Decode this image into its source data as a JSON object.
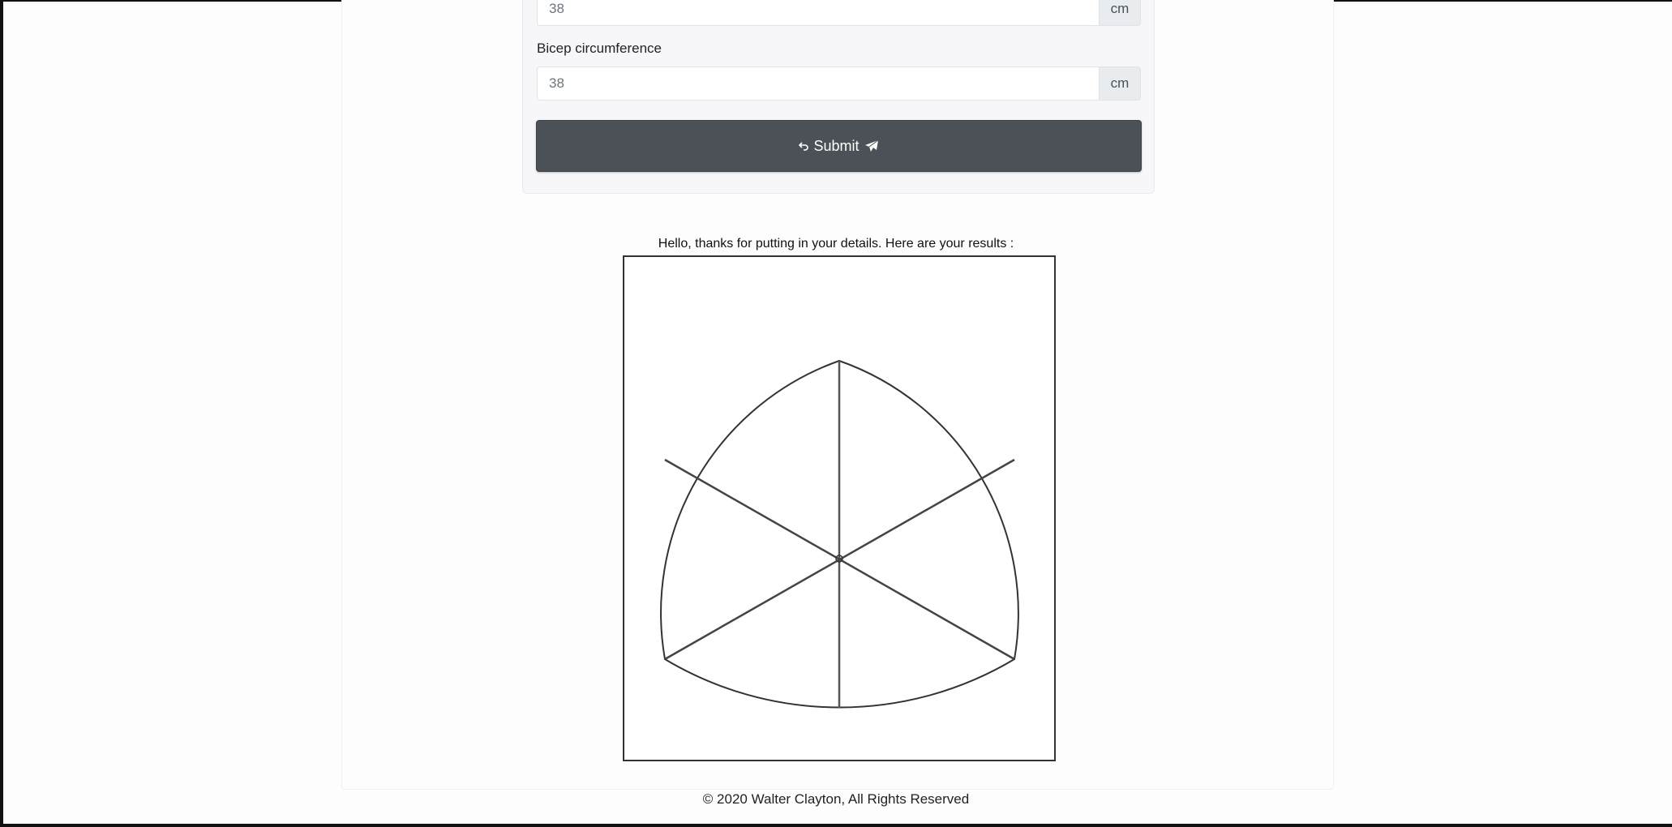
{
  "form": {
    "prev_field": {
      "value": "38",
      "unit": "cm"
    },
    "bicep_field": {
      "label": "Bicep circumference",
      "value": "38",
      "unit": "cm"
    },
    "submit_label": "Submit"
  },
  "results": {
    "message": "Hello, thanks for putting in your details. Here are your results :"
  },
  "footer": {
    "text": "© 2020 Walter Clayton, All Rights Reserved"
  },
  "colors": {
    "button_bg": "#4b5156",
    "unit_bg": "#e9ecef",
    "card_bg": "#f7f7f9",
    "line": "#333333"
  },
  "icons": {
    "submit_left": "undo-arrow-icon",
    "submit_right": "paper-plane-icon"
  }
}
